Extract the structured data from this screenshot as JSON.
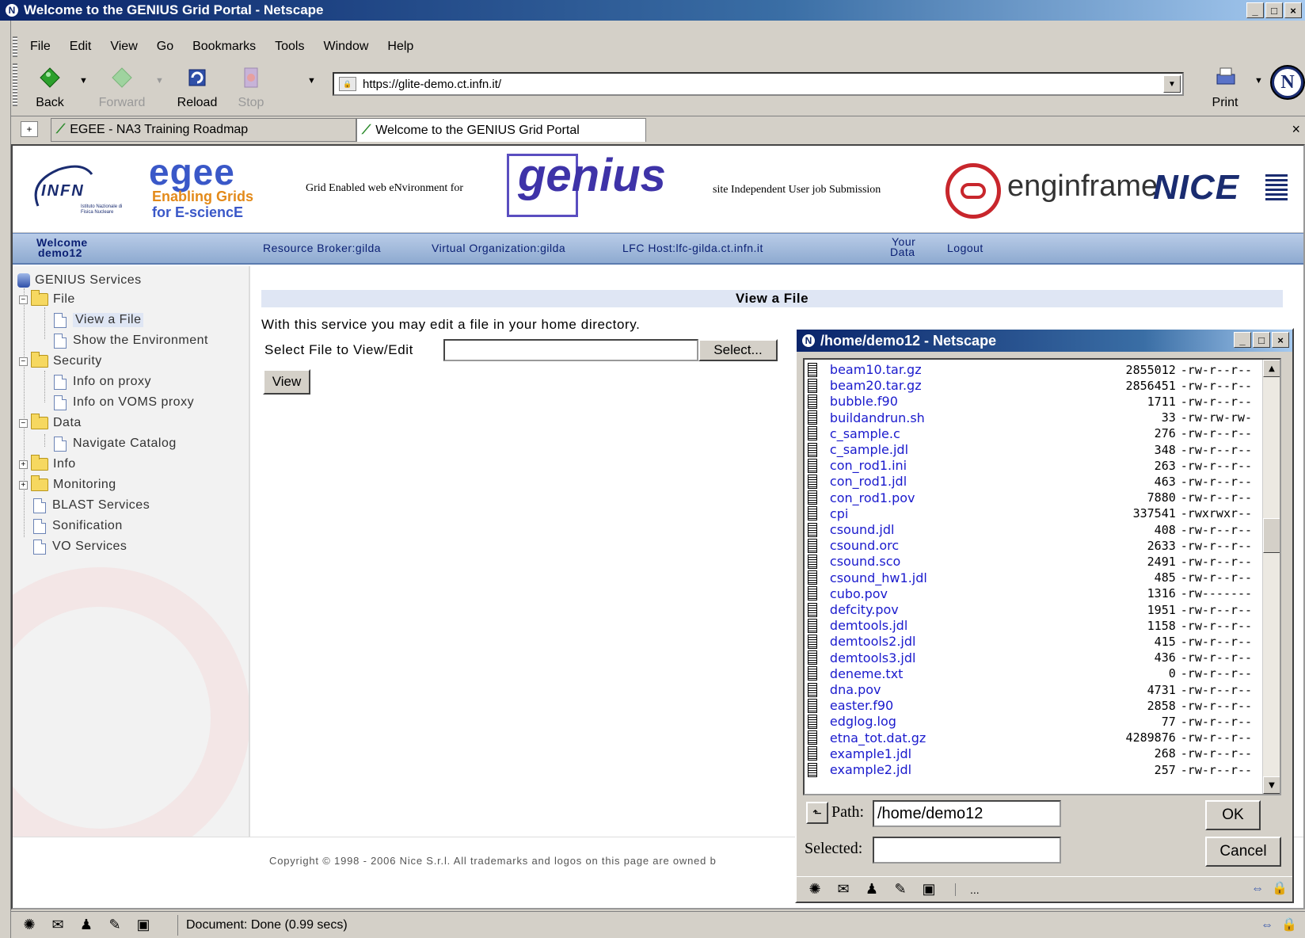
{
  "window": {
    "title": "Welcome to the GENIUS Grid Portal - Netscape"
  },
  "menu": [
    "File",
    "Edit",
    "View",
    "Go",
    "Bookmarks",
    "Tools",
    "Window",
    "Help"
  ],
  "nav": {
    "back": "Back",
    "forward": "Forward",
    "reload": "Reload",
    "stop": "Stop",
    "print": "Print"
  },
  "url": "https://glite-demo.ct.infn.it/",
  "tabs": [
    "EGEE - NA3 Training Roadmap",
    "Welcome to the GENIUS Grid Portal"
  ],
  "banner": {
    "infn": "INFN",
    "infn_sub": "Istituto Nazionale di Fisica Nucleare",
    "egee": "egee",
    "egee_tag1": "Enabling Grids",
    "egee_tag2": "for E-sciencE",
    "genius_tagline": "Grid Enabled web eNvironment for",
    "genius": "genius",
    "site_tagline": "site Independent User job Submission",
    "enginframe": "enginframe",
    "nice": "NICE"
  },
  "bluebar": {
    "welcome": "Welcome",
    "user": "demo12",
    "rb": "Resource Broker:gilda",
    "vo": "Virtual Organization:gilda",
    "lfc": "LFC Host:lfc-gilda.ct.infn.it",
    "your": "Your",
    "data": "Data",
    "logout": "Logout"
  },
  "sidebar": {
    "root": "GENIUS Services",
    "file": "File",
    "view_file": "View a File",
    "show_env": "Show the Environment",
    "security": "Security",
    "info_proxy": "Info on proxy",
    "info_voms": "Info on VOMS proxy",
    "data": "Data",
    "navigate": "Navigate Catalog",
    "info": "Info",
    "monitoring": "Monitoring",
    "blast": "BLAST Services",
    "sonification": "Sonification",
    "vo": "VO Services"
  },
  "content": {
    "heading": "View a File",
    "desc": "With this service you may edit a file in your home directory.",
    "select_label": "Select File to View/Edit",
    "select_btn": "Select...",
    "view_btn": "View"
  },
  "footer": "Copyright © 1998 - 2006 Nice S.r.l. All trademarks and logos on this page are owned b",
  "status": {
    "text": "Document: Done (0.99 secs)"
  },
  "popup": {
    "title": "/home/demo12 - Netscape",
    "path_label": "Path:",
    "path_value": "/home/demo12",
    "selected_label": "Selected:",
    "ok": "OK",
    "cancel": "Cancel",
    "more": "...",
    "files": [
      {
        "name": "beam10.tar.gz",
        "size": "2855012",
        "perm": "-rw-r--r--"
      },
      {
        "name": "beam20.tar.gz",
        "size": "2856451",
        "perm": "-rw-r--r--"
      },
      {
        "name": "bubble.f90",
        "size": "1711",
        "perm": "-rw-r--r--"
      },
      {
        "name": "buildandrun.sh",
        "size": "33",
        "perm": "-rw-rw-rw-"
      },
      {
        "name": "c_sample.c",
        "size": "276",
        "perm": "-rw-r--r--"
      },
      {
        "name": "c_sample.jdl",
        "size": "348",
        "perm": "-rw-r--r--"
      },
      {
        "name": "con_rod1.ini",
        "size": "263",
        "perm": "-rw-r--r--"
      },
      {
        "name": "con_rod1.jdl",
        "size": "463",
        "perm": "-rw-r--r--"
      },
      {
        "name": "con_rod1.pov",
        "size": "7880",
        "perm": "-rw-r--r--"
      },
      {
        "name": "cpi",
        "size": "337541",
        "perm": "-rwxrwxr--"
      },
      {
        "name": "csound.jdl",
        "size": "408",
        "perm": "-rw-r--r--"
      },
      {
        "name": "csound.orc",
        "size": "2633",
        "perm": "-rw-r--r--"
      },
      {
        "name": "csound.sco",
        "size": "2491",
        "perm": "-rw-r--r--"
      },
      {
        "name": "csound_hw1.jdl",
        "size": "485",
        "perm": "-rw-r--r--"
      },
      {
        "name": "cubo.pov",
        "size": "1316",
        "perm": "-rw-------"
      },
      {
        "name": "defcity.pov",
        "size": "1951",
        "perm": "-rw-r--r--"
      },
      {
        "name": "demtools.jdl",
        "size": "1158",
        "perm": "-rw-r--r--"
      },
      {
        "name": "demtools2.jdl",
        "size": "415",
        "perm": "-rw-r--r--"
      },
      {
        "name": "demtools3.jdl",
        "size": "436",
        "perm": "-rw-r--r--"
      },
      {
        "name": "deneme.txt",
        "size": "0",
        "perm": "-rw-r--r--"
      },
      {
        "name": "dna.pov",
        "size": "4731",
        "perm": "-rw-r--r--"
      },
      {
        "name": "easter.f90",
        "size": "2858",
        "perm": "-rw-r--r--"
      },
      {
        "name": "edglog.log",
        "size": "77",
        "perm": "-rw-r--r--"
      },
      {
        "name": "etna_tot.dat.gz",
        "size": "4289876",
        "perm": "-rw-r--r--"
      },
      {
        "name": "example1.jdl",
        "size": "268",
        "perm": "-rw-r--r--"
      },
      {
        "name": "example2.jdl",
        "size": "257",
        "perm": "-rw-r--r--"
      }
    ]
  }
}
